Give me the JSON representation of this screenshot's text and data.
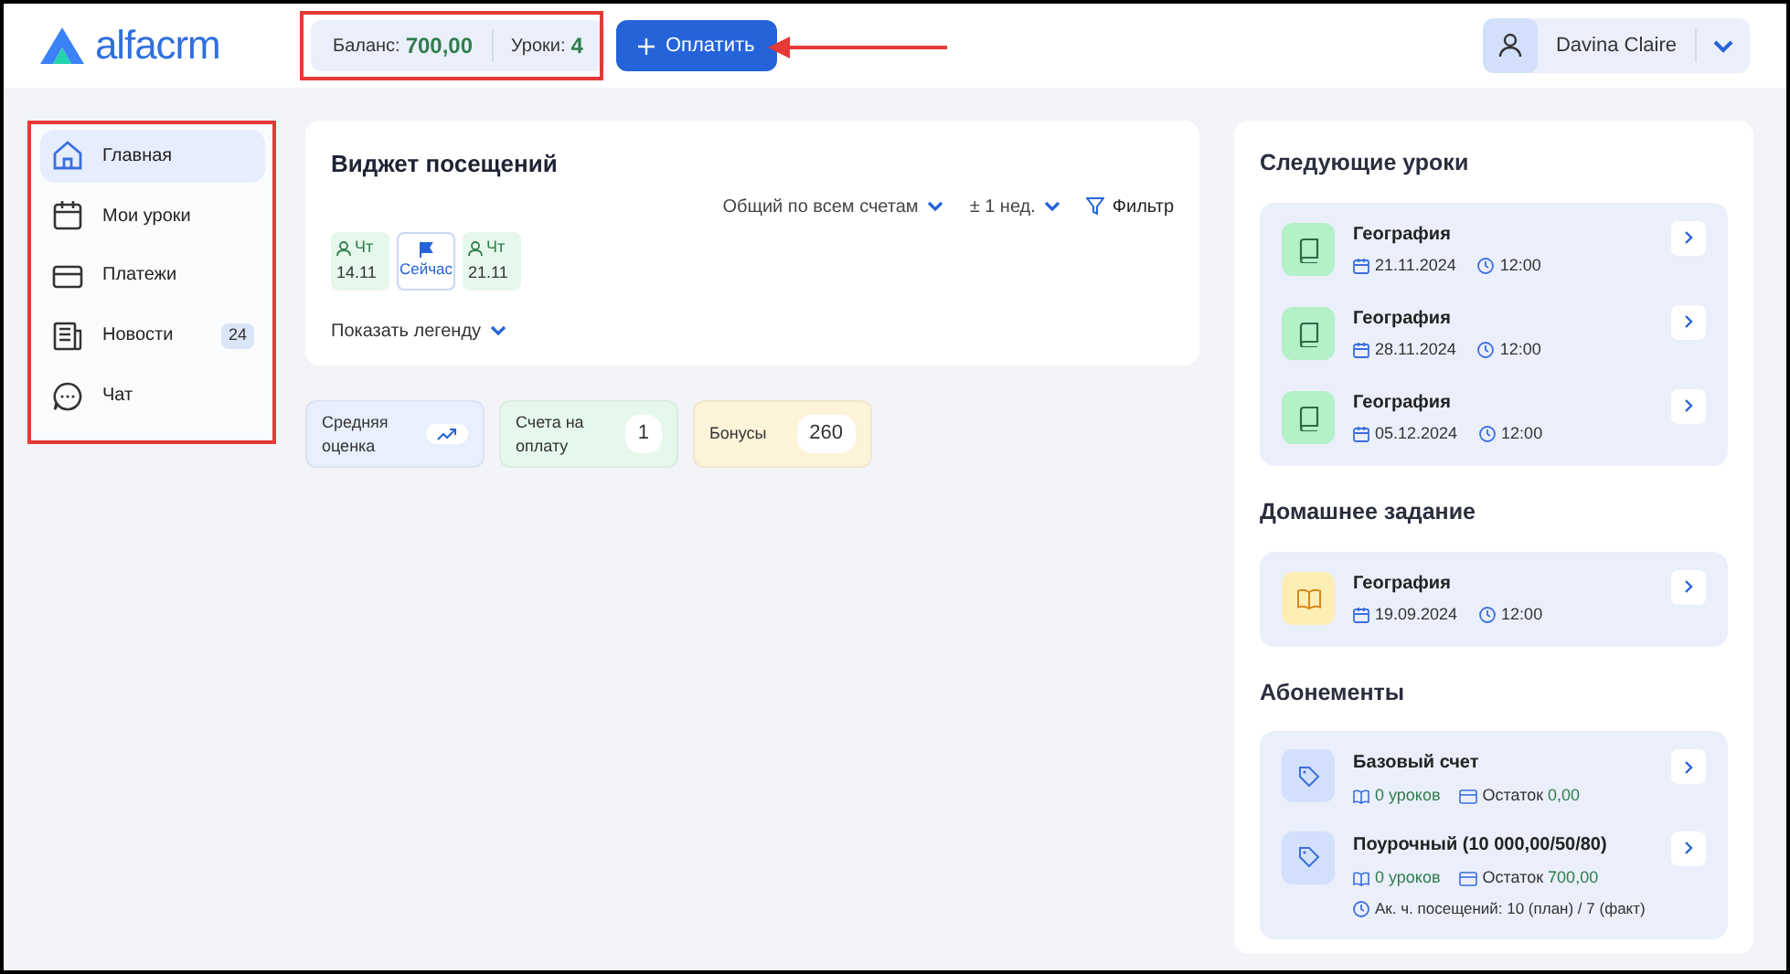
{
  "header": {
    "logo": "alfacrm",
    "balance": {
      "label": "Баланс:",
      "value": "700,00"
    },
    "lessons": {
      "label": "Уроки:",
      "value": "4"
    },
    "pay_button": "Оплатить",
    "user": "Davina Claire"
  },
  "sidebar": {
    "items": [
      {
        "label": "Главная",
        "kind": "home",
        "selected": true
      },
      {
        "label": "Мои уроки",
        "kind": "calendar",
        "selected": false
      },
      {
        "label": "Платежи",
        "kind": "card",
        "selected": false
      },
      {
        "label": "Новости",
        "kind": "news",
        "selected": false,
        "badge": "24"
      },
      {
        "label": "Чат",
        "kind": "chat",
        "selected": false
      }
    ]
  },
  "attendance_widget": {
    "title": "Виджет посещений",
    "filters": [
      "Общий по всем счетам",
      "± 1 нед."
    ],
    "filter_button": "Фильтр",
    "days": [
      {
        "kind": "attended",
        "day": "Чт",
        "date": "14.11"
      },
      {
        "kind": "now",
        "label": "Сейчас"
      },
      {
        "kind": "attended",
        "day": "Чт",
        "date": "21.11"
      }
    ],
    "legend_toggle": "Показать легенду"
  },
  "stats": [
    {
      "label": "Средняя оценка",
      "kind": "trend",
      "color": "#e8effd"
    },
    {
      "label": "Счета на оплату",
      "kind": "count",
      "value": "1",
      "color": "#e6f8ec"
    },
    {
      "label": "Бонусы",
      "kind": "count",
      "value": "260",
      "color": "#fdf3d9"
    }
  ],
  "next_lessons": {
    "title": "Следующие уроки",
    "items": [
      {
        "subject": "География",
        "date": "21.11.2024",
        "time": "12:00"
      },
      {
        "subject": "География",
        "date": "28.11.2024",
        "time": "12:00"
      },
      {
        "subject": "География",
        "date": "05.12.2024",
        "time": "12:00"
      }
    ]
  },
  "homework": {
    "title": "Домашнее задание",
    "items": [
      {
        "subject": "География",
        "date": "19.09.2024",
        "time": "12:00"
      }
    ]
  },
  "subscriptions": {
    "title": "Абонементы",
    "items": [
      {
        "name": "Базовый счет",
        "lessons": "0 уроков",
        "balance_label": "Остаток",
        "balance": "0,00"
      },
      {
        "name": "Поурочный (10 000,00/50/80)",
        "lessons": "0 уроков",
        "balance_label": "Остаток",
        "balance": "700,00",
        "attendance": "Ак. ч. посещений: 10 (план) / 7 (факт)"
      }
    ]
  }
}
